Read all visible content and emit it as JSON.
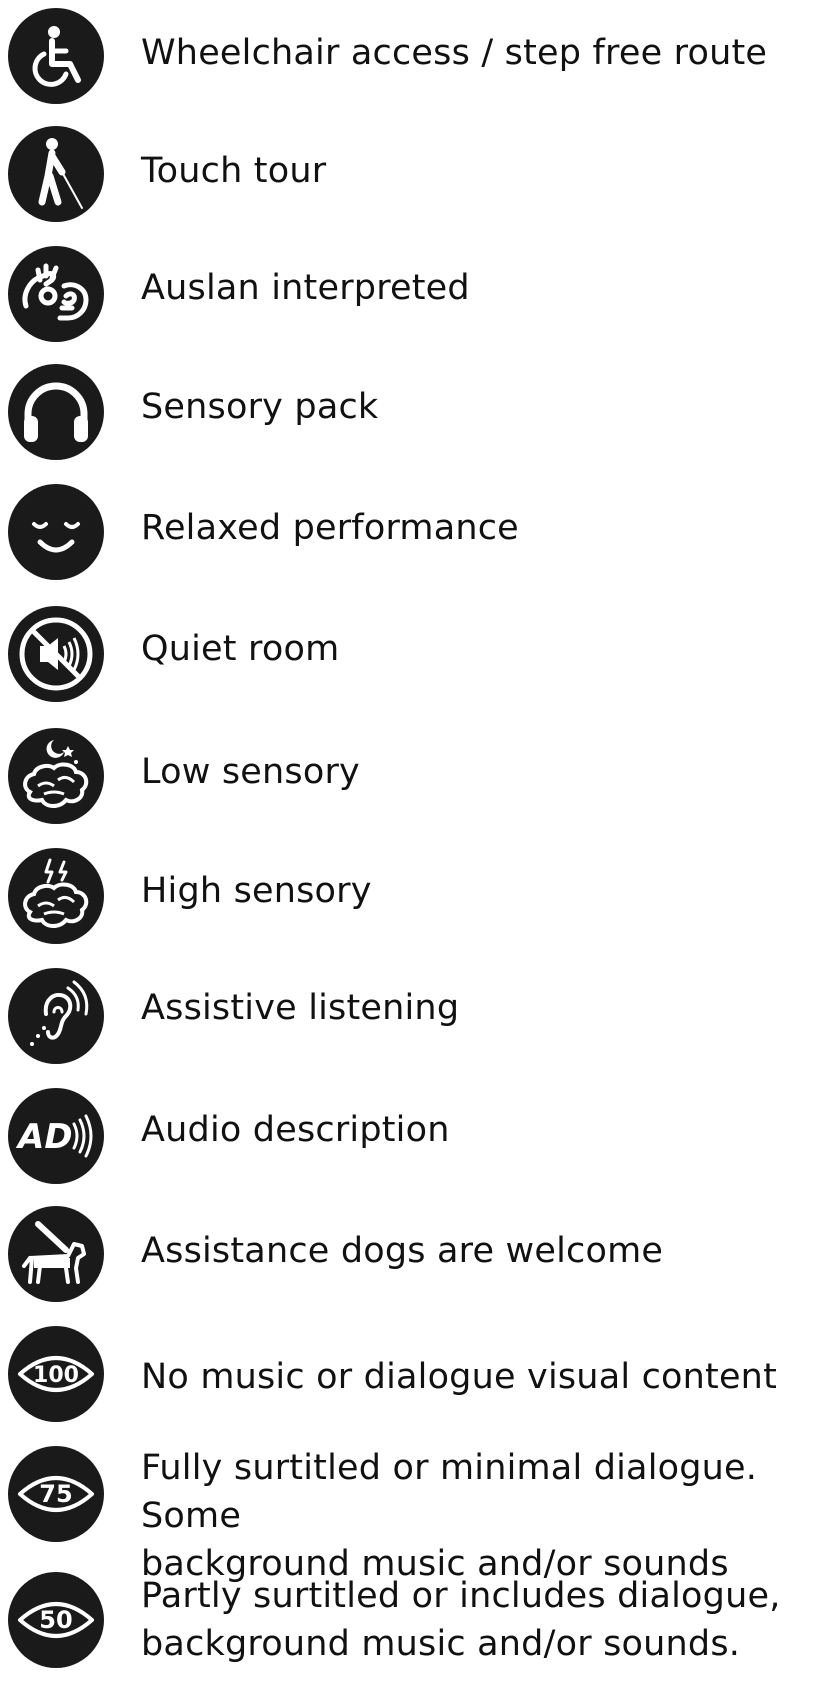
{
  "colors": {
    "icon_bg": "#1a1a1a",
    "icon_fg": "#ffffff",
    "text": "#111111",
    "background": "#ffffff"
  },
  "items": [
    {
      "icon": "wheelchair-icon",
      "label": "Wheelchair access / step free route"
    },
    {
      "icon": "white-cane-icon",
      "label": "Touch tour"
    },
    {
      "icon": "sign-language-icon",
      "label": "Auslan interpreted"
    },
    {
      "icon": "headphones-icon",
      "label": "Sensory pack"
    },
    {
      "icon": "smiley-face-icon",
      "label": "Relaxed performance"
    },
    {
      "icon": "muted-speaker-icon",
      "label": "Quiet room"
    },
    {
      "icon": "brain-moon-icon",
      "label": "Low sensory"
    },
    {
      "icon": "brain-lightning-icon",
      "label": "High sensory"
    },
    {
      "icon": "hearing-loop-icon",
      "label": "Assistive listening"
    },
    {
      "icon": "audio-description-icon",
      "label": "Audio description"
    },
    {
      "icon": "guide-dog-icon",
      "label": "Assistance dogs are welcome"
    },
    {
      "icon": "eye-100-icon",
      "eye_value": "100",
      "label": "No music or dialogue visual content"
    },
    {
      "icon": "eye-75-icon",
      "eye_value": "75",
      "label": "Fully surtitled or minimal dialogue. Some\nbackground music and/or sounds"
    },
    {
      "icon": "eye-50-icon",
      "eye_value": "50",
      "label": "Partly surtitled or includes dialogue,\nbackground music and/or sounds."
    }
  ]
}
